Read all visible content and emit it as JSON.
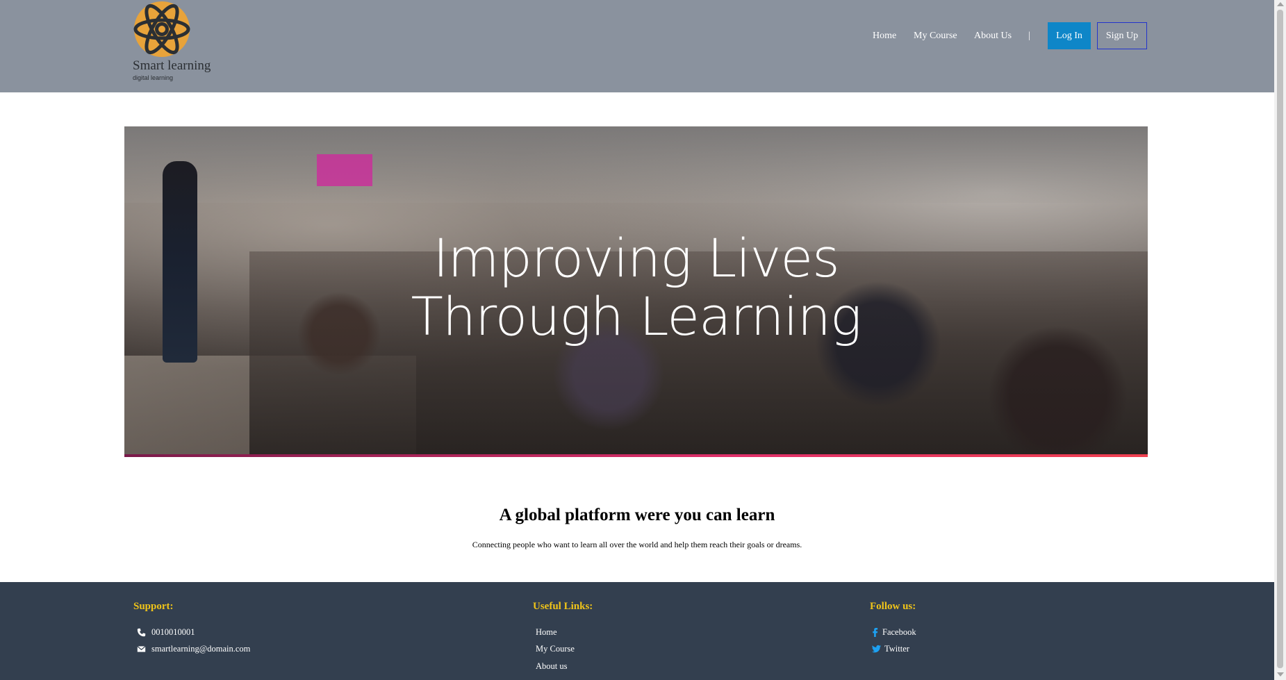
{
  "brand": {
    "name": "Smart learning",
    "tagline": "digital learning",
    "logo_icon": "atom-icon",
    "accent": "#e8a33a"
  },
  "nav": {
    "home": "Home",
    "course": "My Course",
    "about": "About Us",
    "separator": "|",
    "login": "Log In",
    "signup": "Sign Up"
  },
  "hero": {
    "title_line1": "Improving Lives",
    "title_line2": "Through Learning"
  },
  "intro": {
    "title": "A global platform were you can learn",
    "text": "Connecting people who want to learn all over the world and help them reach their goals or dreams."
  },
  "footer": {
    "support": {
      "heading": "Support:",
      "phone": "0010010001",
      "email": "smartlearning@domain.com"
    },
    "links": {
      "heading": "Useful Links:",
      "items": [
        "Home",
        "My Course",
        "About us"
      ]
    },
    "follow": {
      "heading": "Follow us:",
      "facebook": "Facebook",
      "twitter": "Twitter"
    }
  },
  "colors": {
    "header_bg": "#8a929e",
    "login_bg": "#0e86c8",
    "signup_border": "#2233cc",
    "footer_bg": "#333f4f",
    "footer_heading": "#f0c419",
    "social_icon": "#1da1f2"
  }
}
